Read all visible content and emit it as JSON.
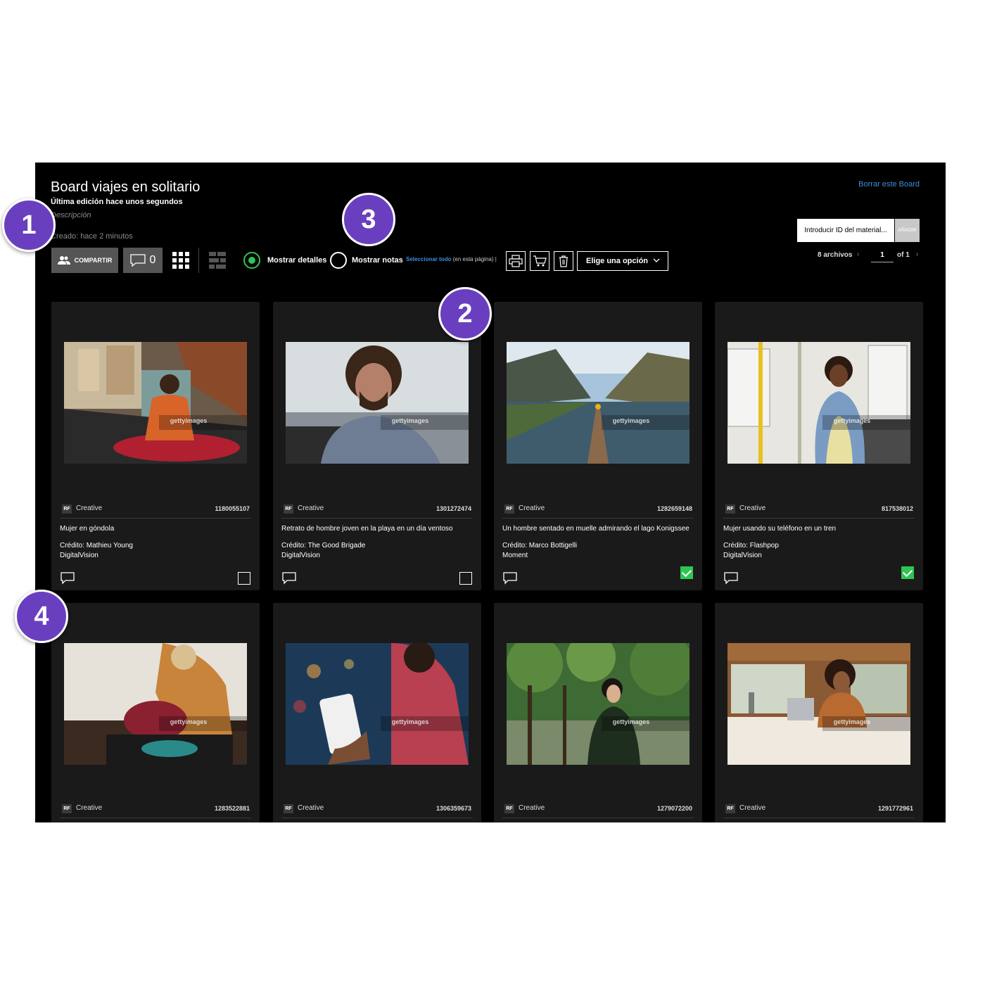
{
  "board": {
    "title": "Board viajes en solitario",
    "last_edit": "Última edición hace unos segundos",
    "description_placeholder": "Descripción",
    "created": "Creado: hace 2 minutos",
    "delete_link": "Borrar este Board"
  },
  "toolbar": {
    "share_label": "COMPARTIR",
    "comment_count": "0",
    "show_details_label": "Mostrar detalles",
    "show_details_selected": true,
    "show_notes_label": "Mostrar notas",
    "show_notes_selected": false,
    "select_all_link": "Seleccionar todo",
    "select_all_suffix": "(en esta página)",
    "select_all_bar": "|",
    "action_dropdown": "Elige una opción"
  },
  "asset_add": {
    "input_placeholder": "Introducir ID del material...",
    "add_label": "AÑADIR"
  },
  "pagination": {
    "file_count": "8 archivos",
    "current_page": "1",
    "of_label": "of 1"
  },
  "cards": [
    {
      "rf": "RF",
      "collection": "Creative",
      "id": "1180055107",
      "caption": "Mujer en góndola",
      "credit_line1": "Crédito: Mathieu Young",
      "credit_line2": "DigitalVision",
      "checked": false,
      "watermark": "gettyimages"
    },
    {
      "rf": "RF",
      "collection": "Creative",
      "id": "1301272474",
      "caption": "Retrato de hombre joven en la playa en un día ventoso",
      "credit_line1": "Crédito: The Good Brigade",
      "credit_line2": "DigitalVision",
      "checked": false,
      "watermark": "gettyimages"
    },
    {
      "rf": "RF",
      "collection": "Creative",
      "id": "1282659148",
      "caption": "Un hombre sentado en muelle admirando el lago Konigssee",
      "credit_line1": "Crédito: Marco Bottigelli",
      "credit_line2": "Moment",
      "checked": true,
      "watermark": "gettyimages"
    },
    {
      "rf": "RF",
      "collection": "Creative",
      "id": "817538012",
      "caption": "Mujer usando su teléfono en un tren",
      "credit_line1": "Crédito: Flashpop",
      "credit_line2": "DigitalVision",
      "checked": true,
      "watermark": "gettyimages"
    },
    {
      "rf": "RF",
      "collection": "Creative",
      "id": "1283522881",
      "watermark": "gettyimages"
    },
    {
      "rf": "RF",
      "collection": "Creative",
      "id": "1306359673",
      "watermark": "gettyimages"
    },
    {
      "rf": "RF",
      "collection": "Creative",
      "id": "1279072200",
      "watermark": "gettyimages"
    },
    {
      "rf": "RF",
      "collection": "Creative",
      "id": "1291772961",
      "watermark": "gettyimages"
    }
  ],
  "callouts": [
    "1",
    "2",
    "3",
    "4"
  ],
  "colors": {
    "accent_green": "#2fc553",
    "link_blue": "#3d8fe0",
    "callout_purple": "#6a3fbf",
    "card_bg": "#1a1a1a"
  }
}
